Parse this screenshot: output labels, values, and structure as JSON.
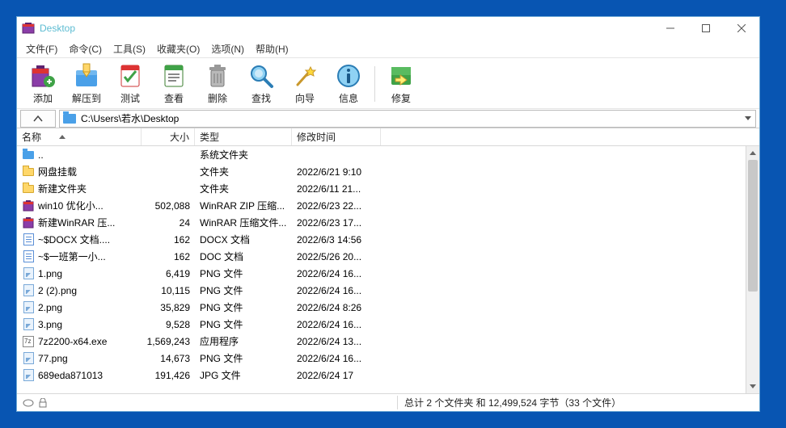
{
  "titlebar": {
    "title": "Desktop"
  },
  "menubar": {
    "items": [
      "文件(F)",
      "命令(C)",
      "工具(S)",
      "收藏夹(O)",
      "选项(N)",
      "帮助(H)"
    ]
  },
  "toolbar": {
    "items": [
      {
        "label": "添加",
        "icon": "add"
      },
      {
        "label": "解压到",
        "icon": "extract"
      },
      {
        "label": "测试",
        "icon": "test"
      },
      {
        "label": "查看",
        "icon": "view"
      },
      {
        "label": "删除",
        "icon": "delete"
      },
      {
        "label": "查找",
        "icon": "find"
      },
      {
        "label": "向导",
        "icon": "wizard"
      },
      {
        "label": "信息",
        "icon": "info"
      }
    ],
    "after_sep": [
      {
        "label": "修复",
        "icon": "repair"
      }
    ]
  },
  "address": {
    "path": "C:\\Users\\若水\\Desktop"
  },
  "columns": {
    "name": "名称",
    "size": "大小",
    "type": "类型",
    "date": "修改时间"
  },
  "rows": [
    {
      "icon": "upfolder",
      "name": "..",
      "size": "",
      "type": "系统文件夹",
      "date": ""
    },
    {
      "icon": "folder",
      "name": "网盘挂载",
      "size": "",
      "type": "文件夹",
      "date": "2022/6/21 9:10"
    },
    {
      "icon": "folder",
      "name": "新建文件夹",
      "size": "",
      "type": "文件夹",
      "date": "2022/6/11 21..."
    },
    {
      "icon": "rar",
      "name": "win10  优化小...",
      "size": "502,088",
      "type": "WinRAR ZIP 压缩...",
      "date": "2022/6/23 22..."
    },
    {
      "icon": "rar",
      "name": "新建WinRAR 压...",
      "size": "24",
      "type": "WinRAR 压缩文件...",
      "date": "2022/6/23 17..."
    },
    {
      "icon": "doc",
      "name": "~$DOCX 文档....",
      "size": "162",
      "type": "DOCX 文档",
      "date": "2022/6/3 14:56"
    },
    {
      "icon": "doc",
      "name": "~$一班第一小...",
      "size": "162",
      "type": "DOC 文档",
      "date": "2022/5/26 20..."
    },
    {
      "icon": "png",
      "name": "1.png",
      "size": "6,419",
      "type": "PNG 文件",
      "date": "2022/6/24 16..."
    },
    {
      "icon": "png",
      "name": "2 (2).png",
      "size": "10,115",
      "type": "PNG 文件",
      "date": "2022/6/24 16..."
    },
    {
      "icon": "png",
      "name": "2.png",
      "size": "35,829",
      "type": "PNG 文件",
      "date": "2022/6/24 8:26"
    },
    {
      "icon": "png",
      "name": "3.png",
      "size": "9,528",
      "type": "PNG 文件",
      "date": "2022/6/24 16..."
    },
    {
      "icon": "exe",
      "name": "7z2200-x64.exe",
      "size": "1,569,243",
      "type": "应用程序",
      "date": "2022/6/24 13..."
    },
    {
      "icon": "png",
      "name": "77.png",
      "size": "14,673",
      "type": "PNG 文件",
      "date": "2022/6/24 16..."
    },
    {
      "icon": "png",
      "name": "689eda871013",
      "size": "191,426",
      "type": "JPG 文件",
      "date": "2022/6/24 17"
    }
  ],
  "status": {
    "summary": "总计 2 个文件夹 和 12,499,524 字节（33 个文件）"
  }
}
